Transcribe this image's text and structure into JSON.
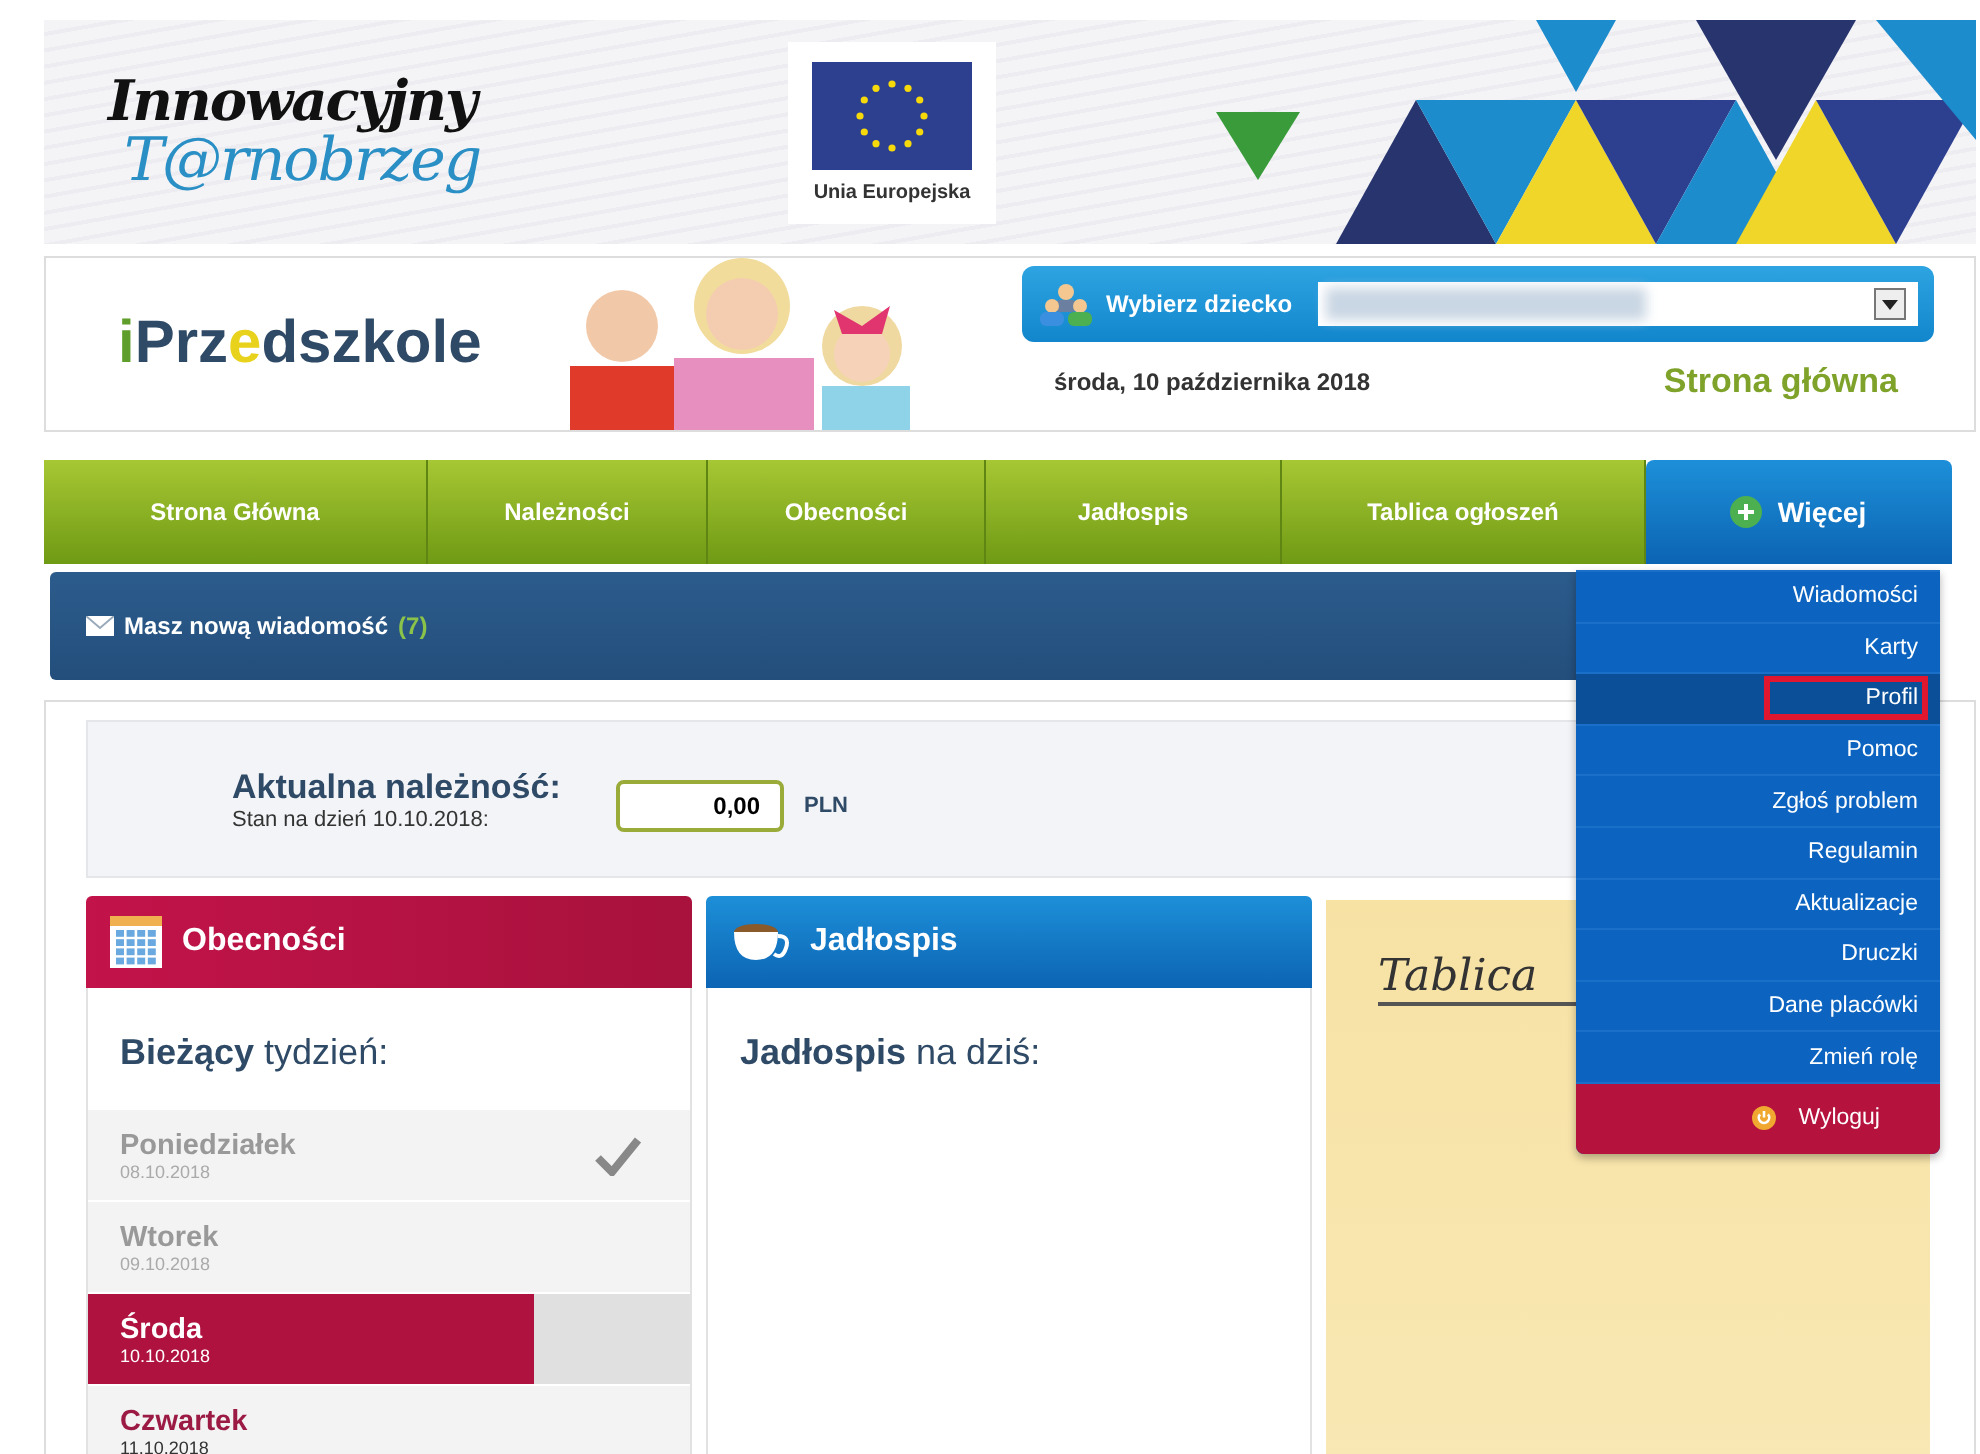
{
  "banner": {
    "logo_lines": [
      "Innowacyjny",
      "T@rnobrzeg"
    ],
    "eu_caption": "Unia Europejska"
  },
  "header": {
    "logo_parts": [
      {
        "text": "i",
        "color": "#5f9e2a"
      },
      {
        "text": "Prz",
        "color": "#2f4a66"
      },
      {
        "text": "e",
        "color": "#e8d21c"
      },
      {
        "text": "dszkole",
        "color": "#2f4a66"
      }
    ],
    "child_label": "Wybierz dziecko",
    "date": "środa, 10 października 2018",
    "page_title": "Strona główna"
  },
  "nav": {
    "tabs": [
      {
        "label": "Strona Główna",
        "selected": false
      },
      {
        "label": "Należności",
        "selected": false
      },
      {
        "label": "Obecności",
        "selected": false
      },
      {
        "label": "Jadłospis",
        "selected": false
      },
      {
        "label": "Tablica ogłoszeń",
        "selected": false
      },
      {
        "label": "Więcej",
        "selected": true
      }
    ]
  },
  "message": {
    "text": "Masz nową wiadomość",
    "count": "(7)"
  },
  "menu": {
    "items": [
      {
        "label": "Wiadomości",
        "kind": "link",
        "selected": false
      },
      {
        "label": "Karty",
        "kind": "link",
        "selected": false
      },
      {
        "label": "Profil",
        "kind": "link",
        "selected": true
      },
      {
        "label": "Pomoc",
        "kind": "link",
        "selected": false
      },
      {
        "label": "Zgłoś problem",
        "kind": "link",
        "selected": false
      },
      {
        "label": "Regulamin",
        "kind": "link",
        "selected": false
      },
      {
        "label": "Aktualizacje",
        "kind": "link",
        "selected": false
      },
      {
        "label": "Druczki",
        "kind": "link",
        "selected": false
      },
      {
        "label": "Dane placówki",
        "kind": "link",
        "selected": false
      },
      {
        "label": "Zmień rolę",
        "kind": "link",
        "selected": false
      },
      {
        "label": "Wyloguj",
        "kind": "logout",
        "selected": false
      }
    ]
  },
  "balance": {
    "title": "Aktualna należność:",
    "subtitle": "Stan na dzień 10.10.2018:",
    "value": "0,00",
    "currency": "PLN"
  },
  "attendance": {
    "title": "Obecności",
    "heading": "**Bieżący** tydzień:",
    "days": [
      {
        "name": "Poniedziałek",
        "date": "08.10.2018",
        "kind": "past",
        "checked": true
      },
      {
        "name": "Wtorek",
        "date": "09.10.2018",
        "kind": "past",
        "checked": false
      },
      {
        "name": "Środa",
        "date": "10.10.2018",
        "kind": "today",
        "checked": false
      },
      {
        "name": "Czwartek",
        "date": "11.10.2018",
        "kind": "future",
        "checked": false
      }
    ]
  },
  "menu_card": {
    "title": "Jadłospis",
    "heading": "**Jadłospis** na dziś:"
  },
  "board": {
    "title": "Tablica"
  }
}
